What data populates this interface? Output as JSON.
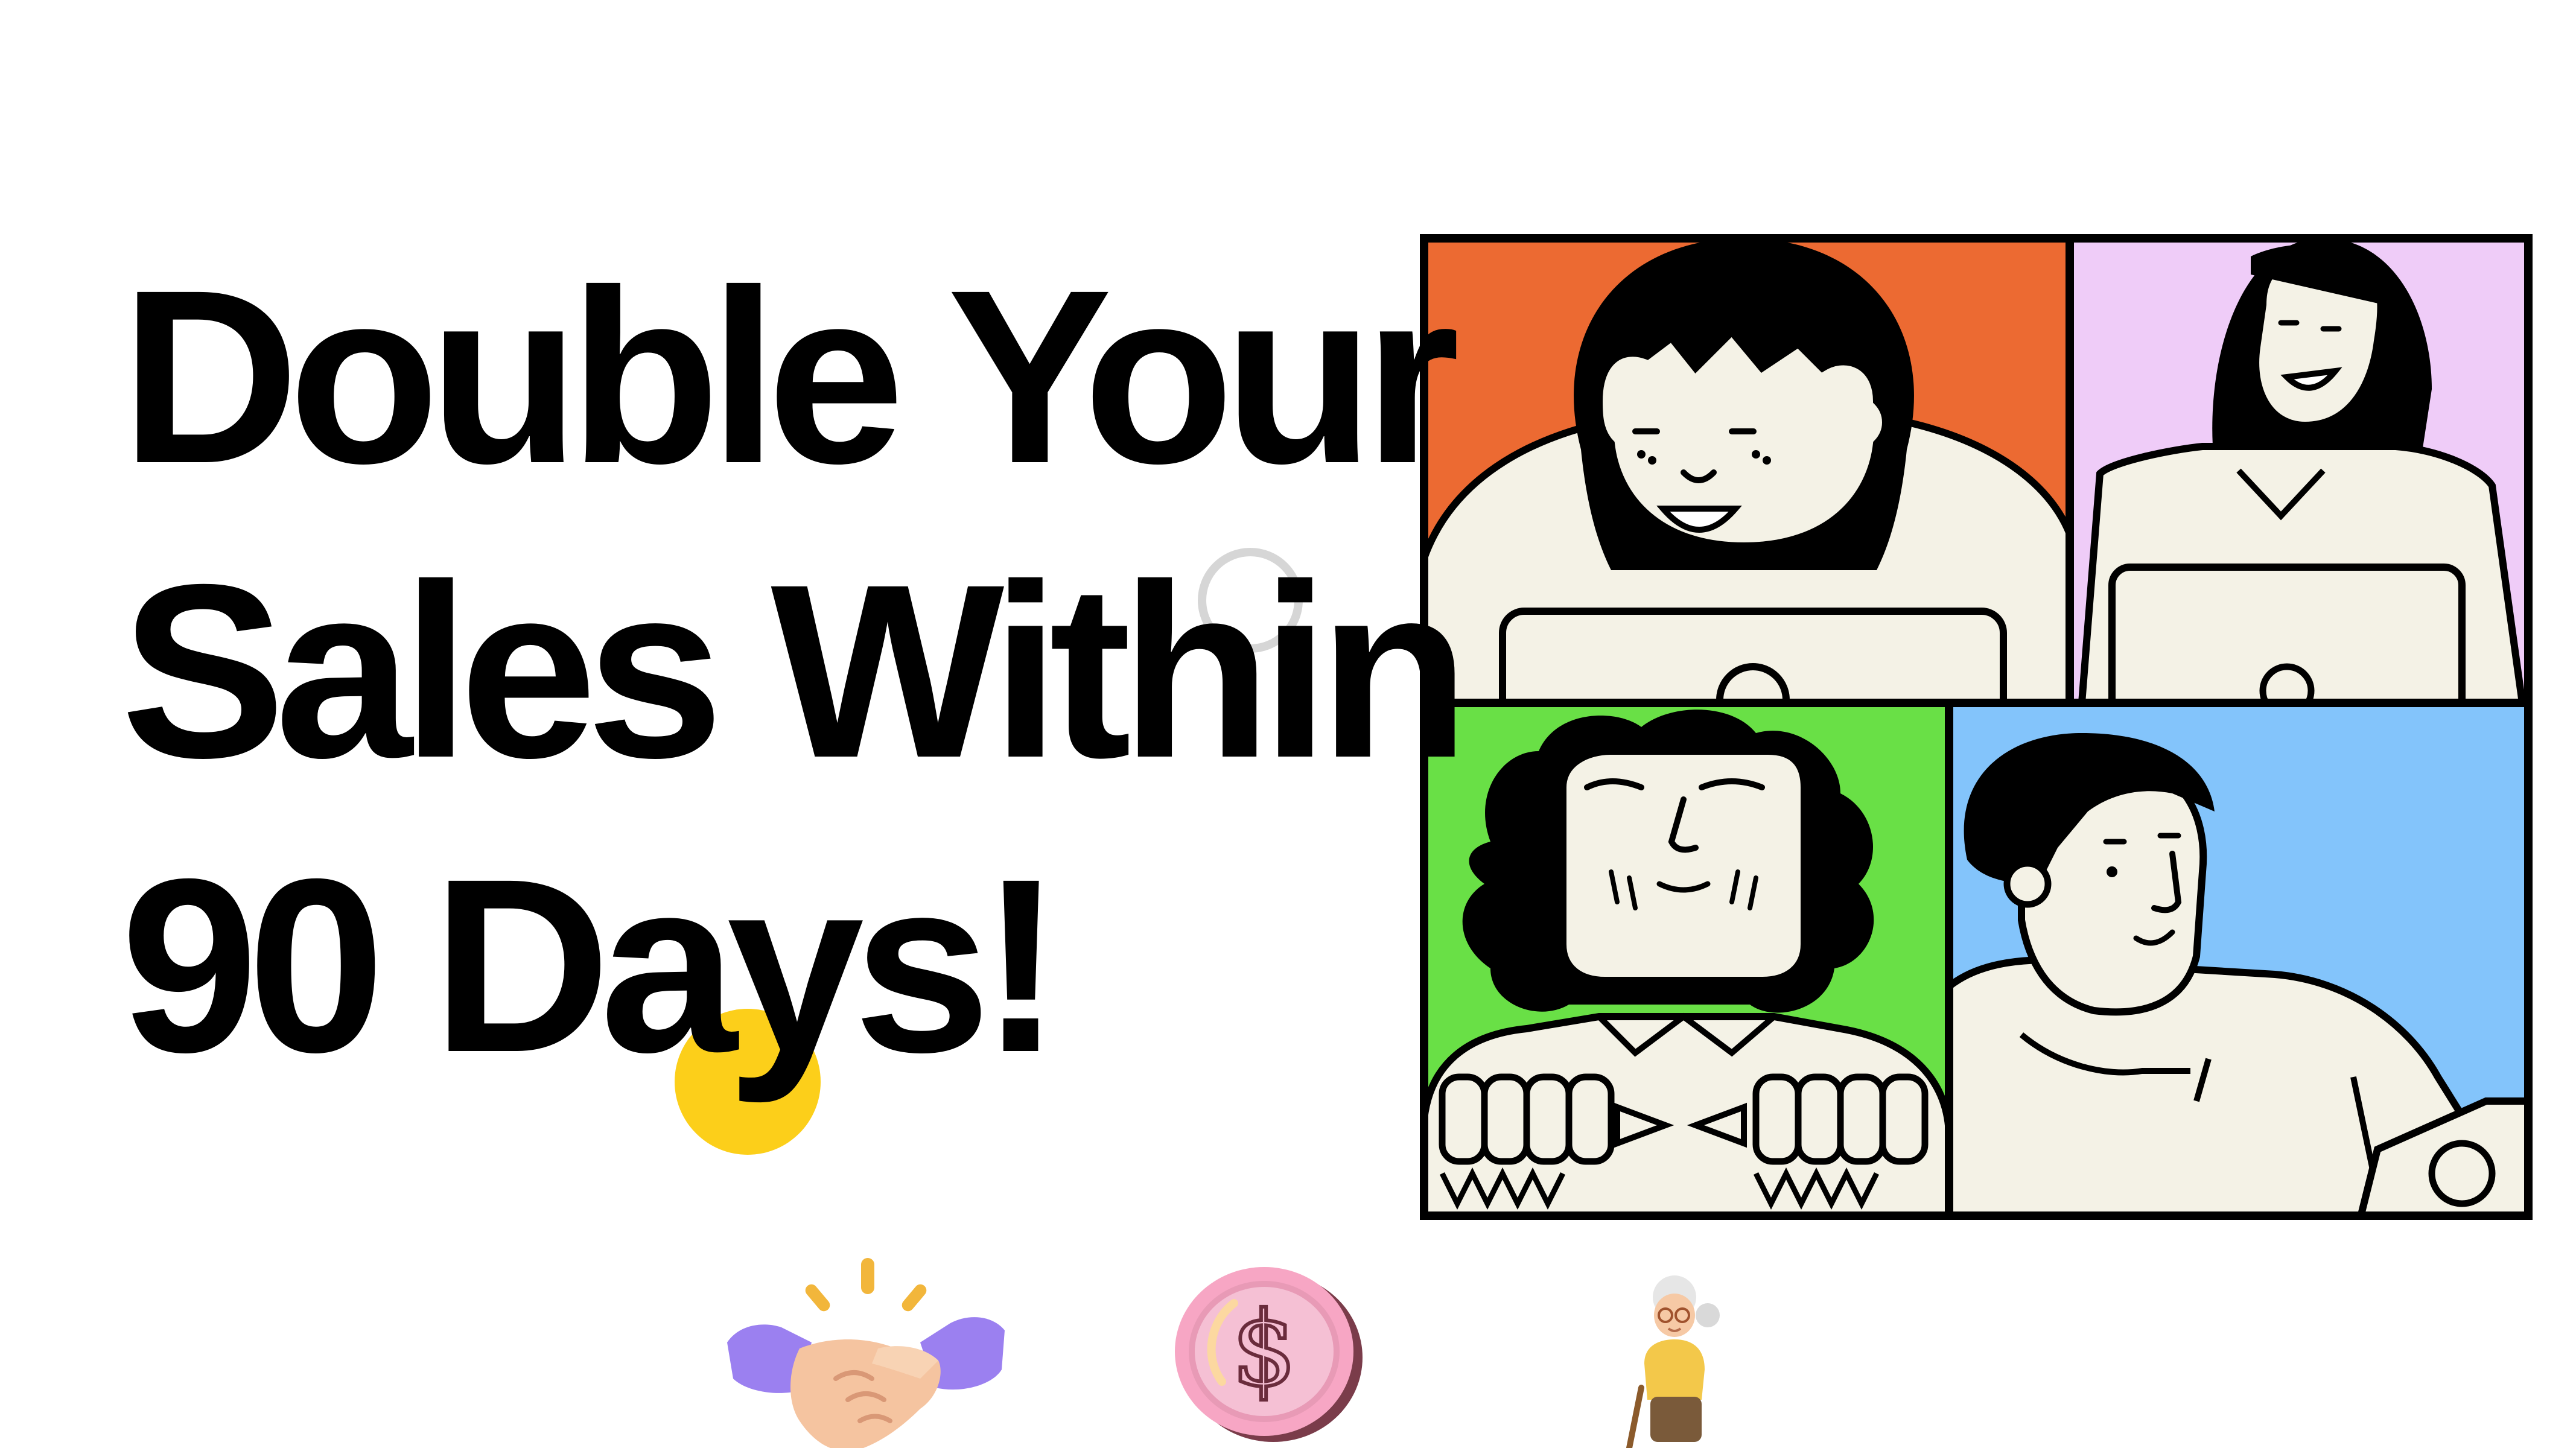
{
  "headline": {
    "line1": "Double Your",
    "line2": "Sales Within",
    "line3": "90 Days!"
  },
  "colors": {
    "text": "#000000",
    "background": "#ffffff",
    "accent_yellow": "#fccf1a",
    "ring_gray": "#d6d6d6",
    "panel_orange": "#ec6a32",
    "panel_pink": "#efccf8",
    "panel_green": "#69e046",
    "panel_blue": "#83c4fb",
    "skin_cream": "#f4f2e6"
  },
  "illustration": {
    "subject": "video-call-grid",
    "panels": [
      "woman-smiling-laptop",
      "woman-laughing-laptop",
      "elderly-woman-curly-hair",
      "man-side-profile"
    ]
  },
  "icons": [
    "handshake-icon",
    "dollar-coin-icon",
    "elderly-woman-icon"
  ]
}
